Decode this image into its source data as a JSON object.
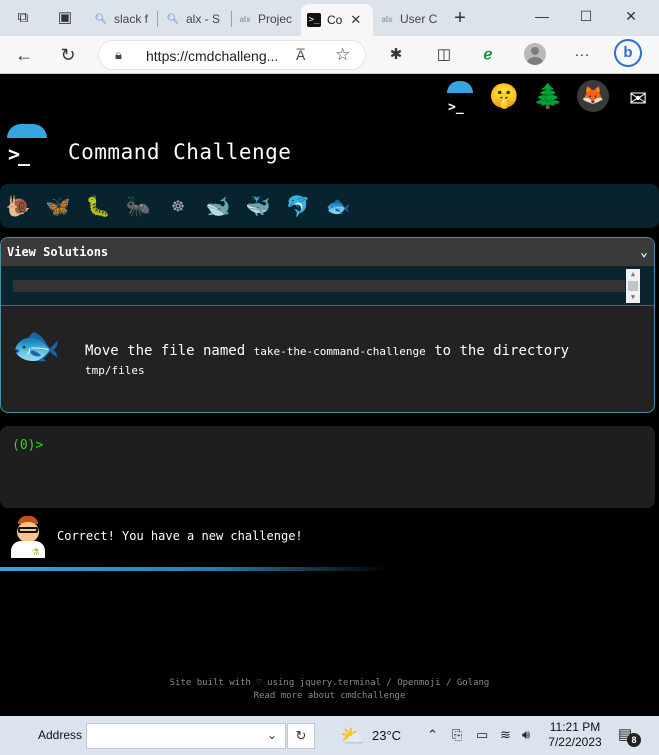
{
  "browser": {
    "tabs": [
      {
        "label": "slack f",
        "favicon": "search-icon"
      },
      {
        "label": "alx - S",
        "favicon": "search-icon"
      },
      {
        "label": "Projec",
        "favicon": "alx"
      },
      {
        "label": "Co",
        "favicon": "terminal-icon",
        "active": true
      },
      {
        "label": "User C",
        "favicon": "alx"
      }
    ],
    "favicon_alx": "alx",
    "favicon_terminal": ">_",
    "new_tab": "+",
    "url": "https://cmdchalleng...",
    "read_aloud": "A̅",
    "bing_letter": "b"
  },
  "page": {
    "title": "Command Challenge",
    "top_icons": [
      "terminal-icon",
      "shushing-face-icon",
      "tree-icon",
      "gitlab-icon",
      "mail-icon"
    ],
    "levels": [
      "snail-icon",
      "butterfly-icon",
      "worm-icon",
      "ant-icon",
      "helm-icon",
      "whale-icon",
      "whale-icon",
      "dolphin-icon",
      "fish-icon"
    ],
    "solutions": {
      "label": "View Solutions"
    },
    "challenge": {
      "text_before": "Move the file named ",
      "filename": "take-the-command-challenge",
      "text_middle": " to the directory ",
      "directory": "tmp/files"
    },
    "terminal": {
      "prompt": "(0)>"
    },
    "feedback": "Correct! You have a new challenge!",
    "footer": {
      "line1": "Site built with ♡ using jquery.terminal / Openmoji / Golang",
      "line2": "Read more about cmdchallenge"
    },
    "colors": {
      "accent": "#37a6e0",
      "prompt": "#2bd52b",
      "level_bar": "#07232d"
    }
  },
  "taskbar": {
    "address_label": "Address",
    "temperature": "23°C",
    "time": "11:21 PM",
    "date": "7/22/2023",
    "notification_count": "8"
  }
}
